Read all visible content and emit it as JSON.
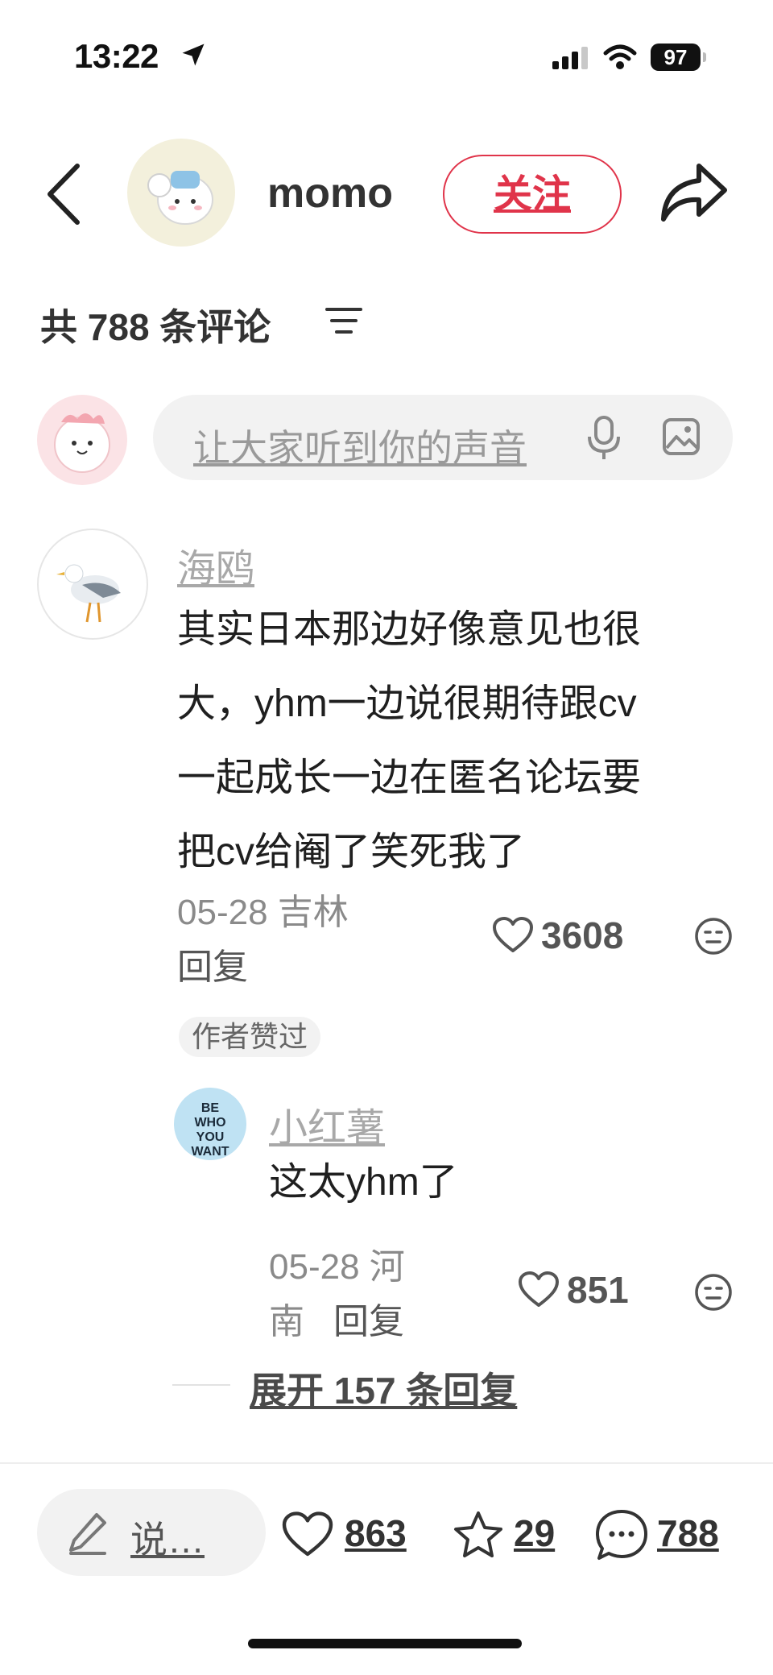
{
  "status_bar": {
    "time": "13:22",
    "battery": "97"
  },
  "header": {
    "author": "momo",
    "follow_label": "关注"
  },
  "comments": {
    "count_label": "共 788 条评论"
  },
  "input": {
    "placeholder": "让大家听到你的声音"
  },
  "comment1": {
    "user": "海鸥",
    "lines": [
      "其实日本那边好像意见也很",
      "大，yhm一边说很期待跟cv",
      "一起成长一边在匿名论坛要",
      "把cv给阉了笑死我了"
    ],
    "meta": "05-28 吉林",
    "reply": "回复",
    "likes": "3608",
    "badge": "作者赞过"
  },
  "reply1": {
    "user": "小红薯",
    "text": "这太yhm了",
    "meta_line1": "05-28 河",
    "meta_line2": "南",
    "reply": "回复",
    "likes": "851"
  },
  "expand_label": "展开 157 条回复",
  "bottom_bar": {
    "say_label": "说…",
    "likes": "863",
    "stars": "29",
    "comments": "788"
  },
  "colors": {
    "accent": "#e0344a",
    "muted": "#a8a8a8"
  },
  "icons": [
    "back-icon",
    "share-icon",
    "filter-icon",
    "mic-icon",
    "image-icon",
    "heart-icon",
    "emoji-icon",
    "pen-icon",
    "star-icon",
    "chat-icon",
    "location-arrow-icon",
    "signal-icon",
    "wifi-icon"
  ]
}
